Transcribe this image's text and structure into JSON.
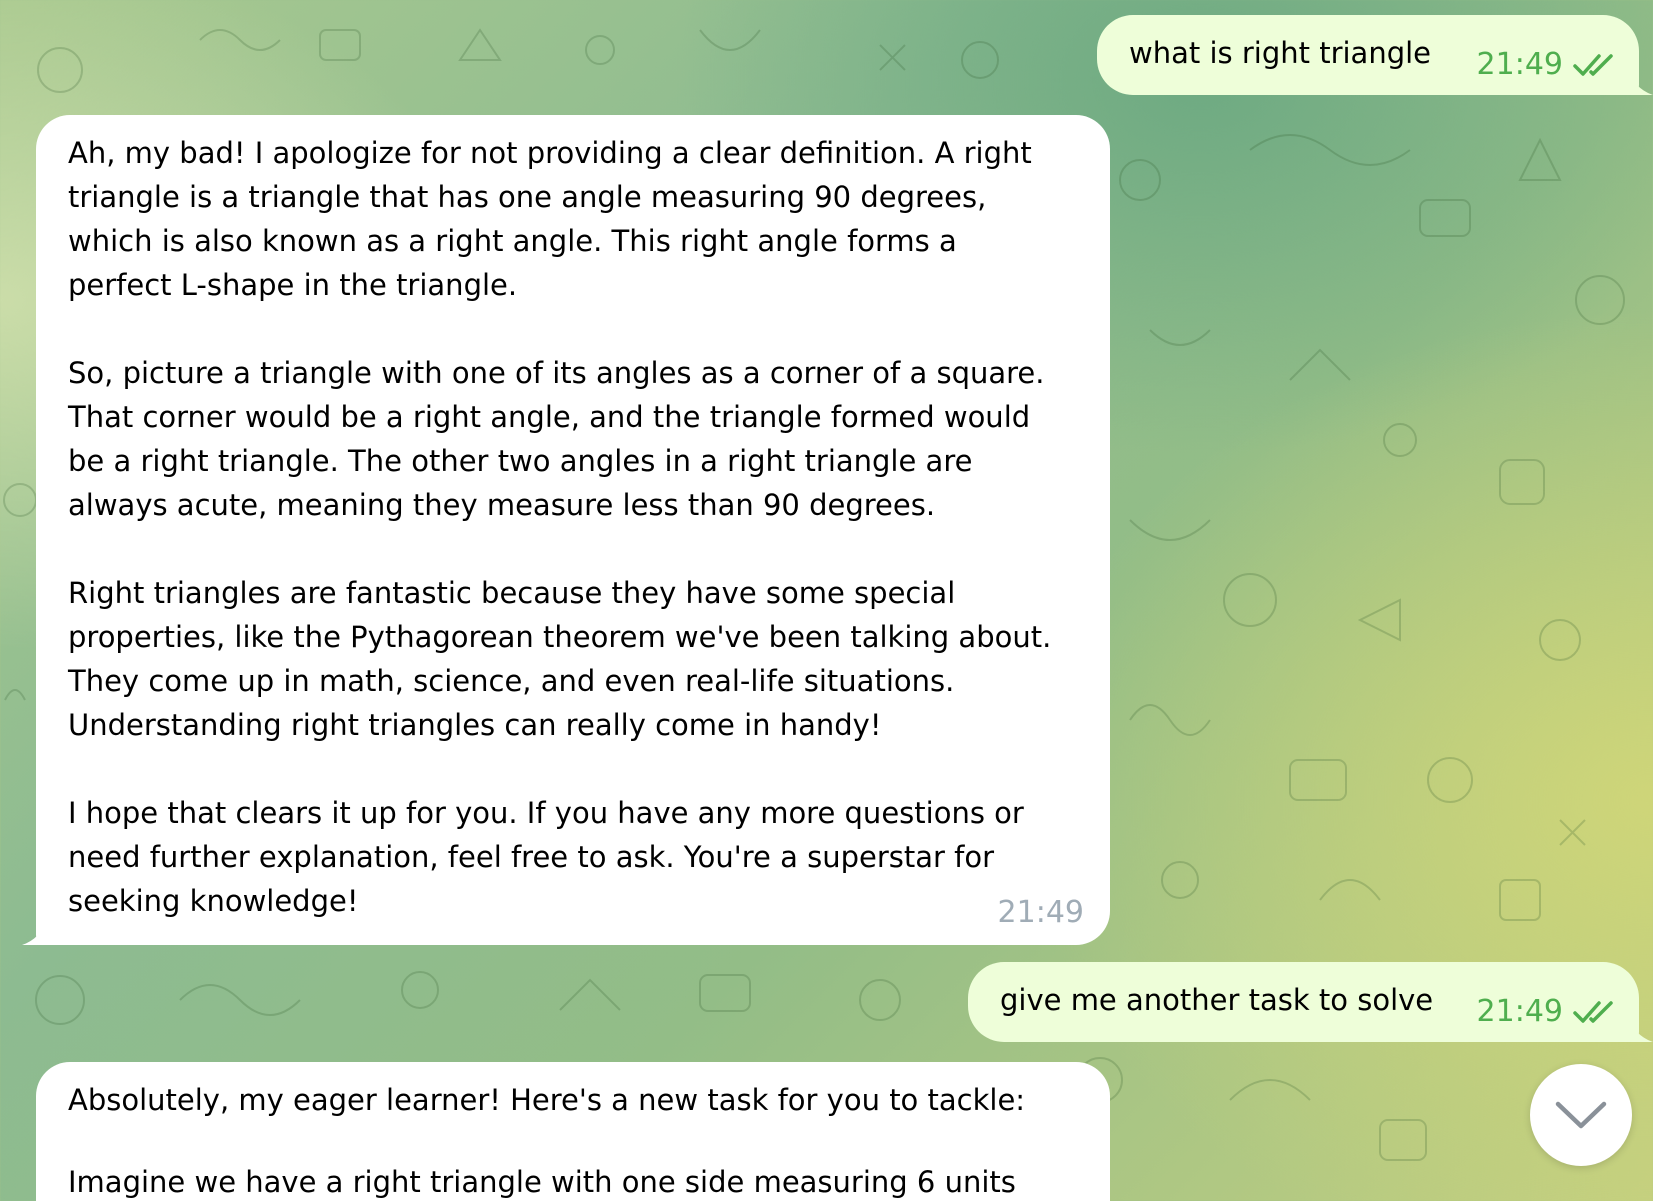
{
  "messages": [
    {
      "direction": "outgoing",
      "text": "what is right triangle",
      "time": "21:49",
      "status_icon": "double-check-icon"
    },
    {
      "direction": "incoming",
      "paragraphs": [
        "Ah, my bad! I apologize for not providing a clear definition. A right\ntriangle is a triangle that has one angle measuring 90 degrees,\nwhich is also known as a right angle. This right angle forms a\nperfect L-shape in the triangle.",
        "So, picture a triangle with one of its angles as a corner of a square.\nThat corner would be a right angle, and the triangle formed would\nbe a right triangle. The other two angles in a right triangle are\nalways acute, meaning they measure less than 90 degrees.",
        "Right triangles are fantastic because they have some special\nproperties, like the Pythagorean theorem we've been talking about.\nThey come up in math, science, and even real-life situations.\nUnderstanding right triangles can really come in handy!",
        "I hope that clears it up for you. If you have any more questions or\nneed further explanation, feel free to ask. You're a superstar for\nseeking knowledge!"
      ],
      "time": "21:49"
    },
    {
      "direction": "outgoing",
      "text": "give me another task to solve",
      "time": "21:49",
      "status_icon": "double-check-icon"
    },
    {
      "direction": "incoming",
      "paragraphs": [
        "Absolutely, my eager learner! Here's a new task for you to tackle:",
        "Imagine we have a right triangle with one side measuring 6 units"
      ]
    }
  ],
  "scroll_button": {
    "icon": "chevron-down-icon"
  },
  "colors": {
    "outgoing_bubble": "#eefed9",
    "incoming_bubble": "#ffffff",
    "outgoing_meta": "#4fae4e",
    "incoming_meta": "#a0acb6"
  }
}
